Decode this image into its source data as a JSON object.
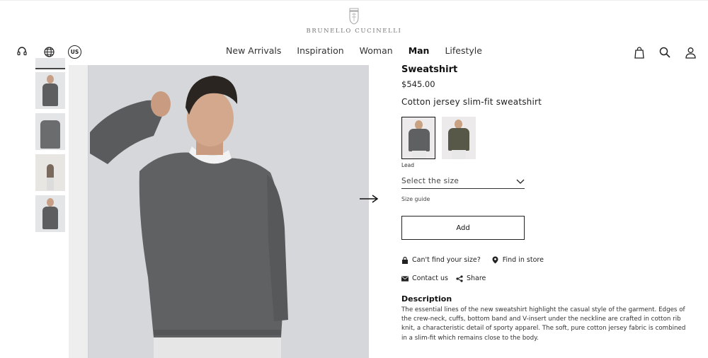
{
  "brand": {
    "name": "BRUNELLO CUCINELLI",
    "crest_icon": "crest-logo-icon"
  },
  "utility": {
    "support_icon": "headset-icon",
    "globe_icon": "globe-icon",
    "country": "US"
  },
  "nav": {
    "items": [
      {
        "label": "New Arrivals"
      },
      {
        "label": "Inspiration"
      },
      {
        "label": "Woman"
      },
      {
        "label": "Man",
        "active": true
      },
      {
        "label": "Lifestyle"
      }
    ]
  },
  "header_icons": [
    "shopping-bag-icon",
    "search-icon",
    "account-icon"
  ],
  "gallery": {
    "thumbnail_count": 5,
    "next_arrow": "arrow-right-icon"
  },
  "product": {
    "title": "Sweatshirt",
    "price": "$545.00",
    "subtitle": "Cotton jersey slim-fit sweatshirt",
    "colors": [
      {
        "name": "Lead",
        "hex": "#5f6062",
        "selected": true
      },
      {
        "name": "",
        "hex": "#575848",
        "selected": false
      }
    ],
    "selected_color_label": "Lead",
    "size_placeholder": "Select the size",
    "size_guide": "Size guide",
    "add_label": "Add",
    "cant_find_size": "Can't find your size?",
    "find_in_store": "Find in store",
    "contact_us": "Contact us",
    "share": "Share",
    "description_heading": "Description",
    "description_text": "The essential lines of the new sweatshirt highlight the casual style of the garment. Edges of the crew-neck, cuffs, bottom band and V-insert under the neckline are crafted in cotton rib knit, a characteristic detail of sporty apparel. The soft, pure cotton jersey fabric is combined in a slim-fit which remains close to the body."
  }
}
